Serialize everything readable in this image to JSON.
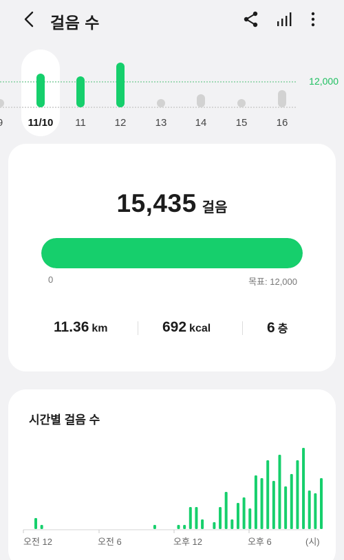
{
  "header": {
    "title": "걸음 수",
    "icons": [
      "chevron-left-icon",
      "share-icon",
      "bar-chart-icon",
      "more-vert-icon"
    ]
  },
  "week": {
    "goal_label": "12,000",
    "days": [
      {
        "label": "9",
        "steps": 0
      },
      {
        "label": "11/10",
        "steps": 15435,
        "selected": true
      },
      {
        "label": "11",
        "steps": 14200
      },
      {
        "label": "12",
        "steps": 20500
      },
      {
        "label": "13",
        "steps": 0
      },
      {
        "label": "14",
        "steps": 6000
      },
      {
        "label": "15",
        "steps": 0
      },
      {
        "label": "16",
        "steps": 7800
      }
    ]
  },
  "summary": {
    "steps": "15,435",
    "steps_unit": "걸음",
    "progress_fraction": 1.0,
    "progress_min": "0",
    "progress_goal": "목표: 12,000",
    "distance_value": "11.36",
    "distance_unit": "km",
    "calories_value": "692",
    "calories_unit": "kcal",
    "floors_value": "6",
    "floors_unit": "층"
  },
  "hourly": {
    "title": "시간별 걸음 수",
    "accent": "#16cf6c",
    "x_labels": [
      "오전 12",
      "오전 6",
      "오후 12",
      "오후 6",
      "(시)"
    ]
  },
  "chart_data": {
    "type": "bar",
    "title": "시간별 걸음 수",
    "xlabel": "(시)",
    "ylabel": "",
    "x_tick_labels": [
      "오전 12",
      "오전 6",
      "오후 12",
      "오후 6"
    ],
    "note_units": "relative bar heights (no y-axis printed)",
    "values": [
      16,
      6,
      0,
      0,
      0,
      0,
      0,
      0,
      0,
      0,
      0,
      0,
      0,
      0,
      0,
      0,
      0,
      0,
      0,
      0,
      6,
      0,
      0,
      0,
      6,
      6,
      32,
      32,
      14,
      0,
      10,
      32,
      54,
      14,
      38,
      46,
      30,
      78,
      74,
      100,
      70,
      108,
      62,
      80,
      100,
      118,
      56,
      52,
      74
    ],
    "bin_hours": 0.5,
    "ylim": [
      0,
      118
    ]
  }
}
